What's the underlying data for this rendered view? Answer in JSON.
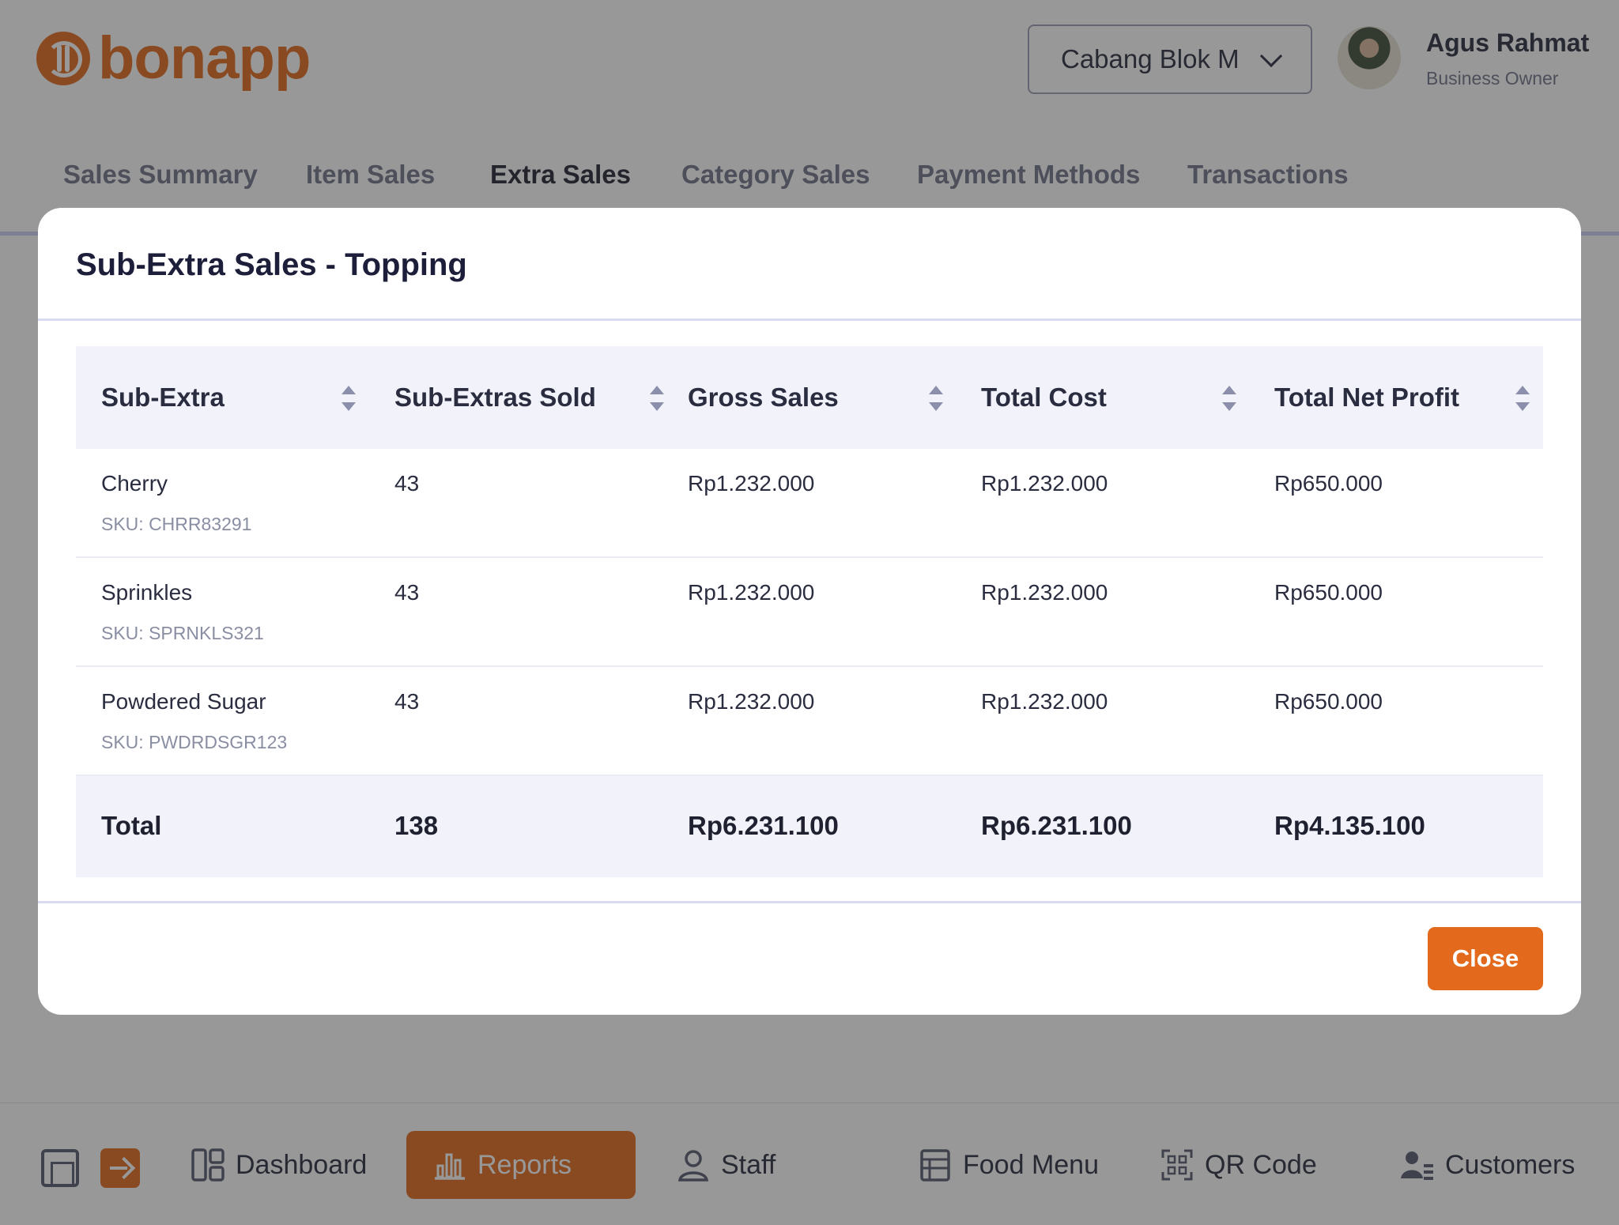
{
  "header": {
    "brand": "bonapp",
    "branch_selector": "Cabang Blok M",
    "user": {
      "name": "Agus Rahmat",
      "role": "Business Owner"
    }
  },
  "tabs": [
    {
      "label": "Sales Summary"
    },
    {
      "label": "Item Sales"
    },
    {
      "label": "Extra Sales",
      "active": true
    },
    {
      "label": "Category Sales"
    },
    {
      "label": "Payment Methods"
    },
    {
      "label": "Transactions"
    }
  ],
  "modal": {
    "title": "Sub-Extra Sales - Topping",
    "columns": [
      "Sub-Extra",
      "Sub-Extras Sold",
      "Gross Sales",
      "Total Cost",
      "Total Net Profit"
    ],
    "rows": [
      {
        "name": "Cherry",
        "sku": "SKU: CHRR83291",
        "sold": "43",
        "gross": "Rp1.232.000",
        "cost": "Rp1.232.000",
        "profit": "Rp650.000"
      },
      {
        "name": "Sprinkles",
        "sku": "SKU: SPRNKLS321",
        "sold": "43",
        "gross": "Rp1.232.000",
        "cost": "Rp1.232.000",
        "profit": "Rp650.000"
      },
      {
        "name": "Powdered Sugar",
        "sku": "SKU: PWDRDSGR123",
        "sold": "43",
        "gross": "Rp1.232.000",
        "cost": "Rp1.232.000",
        "profit": "Rp650.000"
      }
    ],
    "total": {
      "label": "Total",
      "sold": "138",
      "gross": "Rp6.231.100",
      "cost": "Rp6.231.100",
      "profit": "Rp4.135.100"
    },
    "close_label": "Close"
  },
  "bottom_nav": [
    {
      "label": "Dashboard",
      "icon": "dashboard-icon"
    },
    {
      "label": "Reports",
      "icon": "bar-chart-icon",
      "active": true
    },
    {
      "label": "Staff",
      "icon": "user-icon"
    },
    {
      "label": "Food Menu",
      "icon": "menu-icon"
    },
    {
      "label": "QR Code",
      "icon": "qr-code-icon"
    },
    {
      "label": "Customers",
      "icon": "users-icon"
    }
  ],
  "colors": {
    "accent": "#e36a1c",
    "header_bg": "#f2f3fa",
    "divider": "#d9dbf3"
  }
}
